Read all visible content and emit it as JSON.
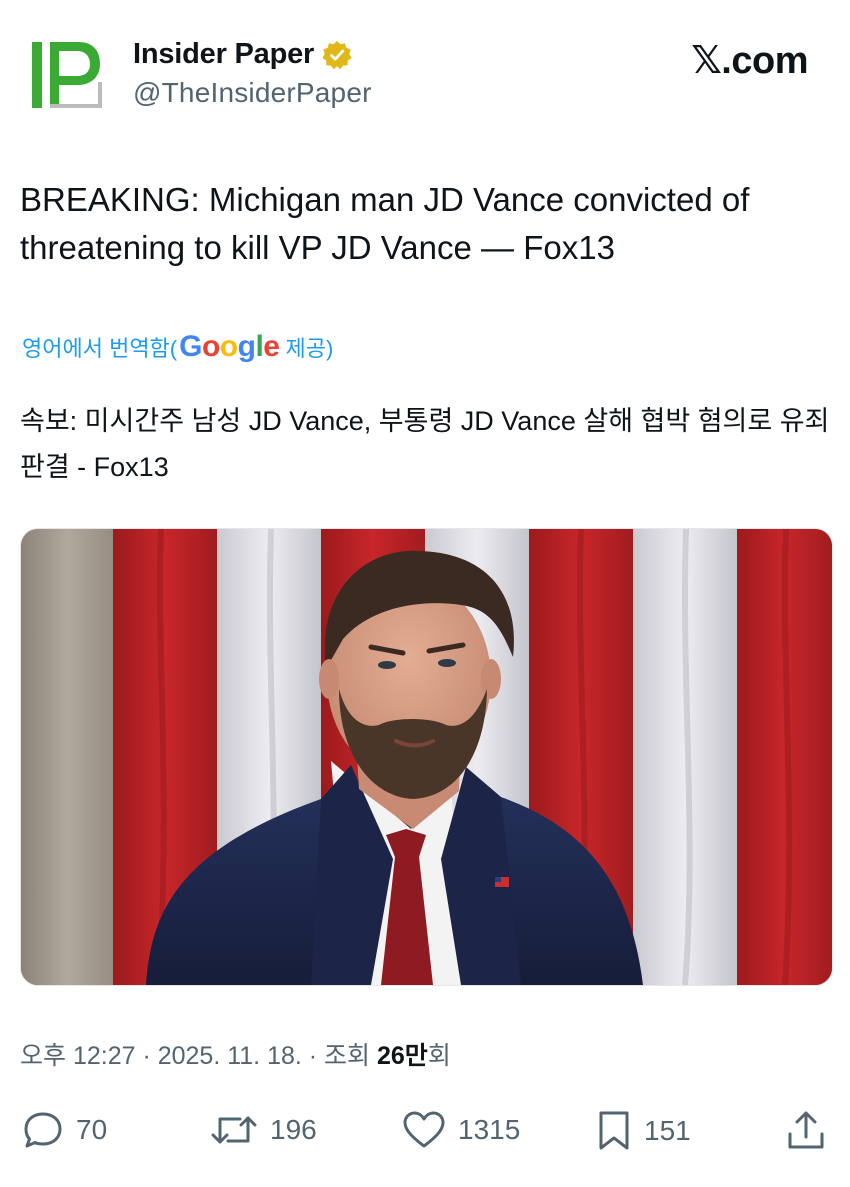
{
  "header": {
    "logo_text": "IP",
    "author_name": "Insider Paper",
    "handle": "@TheInsiderPaper",
    "brand": "𝕏.com"
  },
  "tweet": {
    "text": "BREAKING: Michigan man JD Vance convicted of threatening to kill VP JD Vance — Fox13"
  },
  "translation": {
    "label_prefix": "영어에서 번역함(",
    "provider": "Google",
    "label_suffix": " 제공)",
    "text": "속보: 미시간주 남성 JD Vance, 부통령 JD Vance 살해 협박 혐의로 유죄 판결 - Fox13"
  },
  "meta": {
    "time_date": "오후 12:27 · 2025. 11. 18. · 조회 ",
    "views": "26만",
    "views_suffix": "회"
  },
  "actions": {
    "replies": "70",
    "reposts": "196",
    "likes": "1315",
    "bookmarks": "151"
  },
  "colors": {
    "accent": "#1d9bf0",
    "logo_green": "#3aaa35",
    "verified_gold": "#e2b719",
    "muted": "#536471"
  }
}
